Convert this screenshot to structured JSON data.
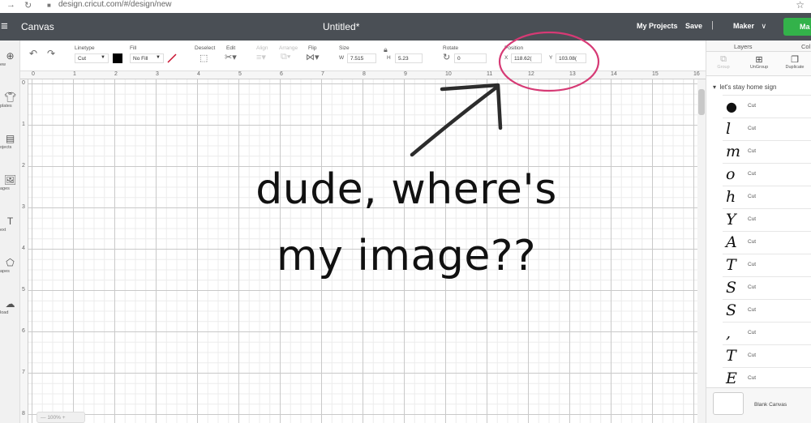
{
  "browser": {
    "nav_icons": [
      "arrow-right-icon",
      "refresh-icon",
      "lock-icon"
    ],
    "url": "design.cricut.com/#/design/new",
    "bookmark_icon": "star-icon"
  },
  "header": {
    "menu_icon": "hamburger-icon",
    "app_title": "Canvas",
    "doc_title": "Untitled*",
    "my_projects": "My Projects",
    "save": "Save",
    "separator": "|",
    "machine": "Maker",
    "machine_chevron": "∨",
    "make_label": "Ma",
    "accent_color": "#33b24a",
    "bg_color": "#4a4f55"
  },
  "toolbar": {
    "undo_icon": "undo-icon",
    "redo_icon": "redo-icon",
    "linetype_label": "Linetype",
    "linetype_value": "Cut",
    "fill_label": "Fill",
    "fill_value": "No Fill",
    "deselect_label": "Deselect",
    "edit_label": "Edit",
    "align_label": "Align",
    "arrange_label": "Arrange",
    "flip_label": "Flip",
    "size_label": "Size",
    "size_w_label": "W",
    "size_w": "7.515",
    "size_h_label": "H",
    "size_h": "5.23",
    "rotate_label": "Rotate",
    "rotate_value": "0",
    "position_label": "Position",
    "pos_x_label": "X",
    "pos_x": "118.62(",
    "pos_y_label": "Y",
    "pos_y": "103.08("
  },
  "left_nav": [
    {
      "icon": "plus-icon",
      "label": "ew"
    },
    {
      "icon": "shirt-icon",
      "label": "plates"
    },
    {
      "icon": "projects-icon",
      "label": "ojects"
    },
    {
      "icon": "images-icon",
      "label": "ages"
    },
    {
      "icon": "text-icon",
      "label": "ext"
    },
    {
      "icon": "shapes-icon",
      "label": "apes"
    },
    {
      "icon": "upload-icon",
      "label": "load"
    }
  ],
  "ruler": {
    "h": [
      "0",
      "1",
      "2",
      "3",
      "4",
      "5",
      "6",
      "7",
      "8",
      "9",
      "10",
      "11",
      "12",
      "13",
      "14",
      "15",
      "16"
    ],
    "v": [
      "0",
      "1",
      "2",
      "3",
      "4",
      "5",
      "6",
      "7",
      "8"
    ]
  },
  "zoom": "100%",
  "caption": {
    "line1": "dude, where's",
    "line2": "my image??"
  },
  "annotation_color": "#d63a75",
  "right_panel": {
    "tab_layers": "Layers",
    "tab_color": "Col",
    "tools": [
      {
        "icon": "group-icon",
        "label": "Group",
        "enabled": false
      },
      {
        "icon": "ungroup-icon",
        "label": "UnGroup",
        "enabled": true
      },
      {
        "icon": "duplicate-icon",
        "label": "Duplicate",
        "enabled": true
      }
    ],
    "group_name": "let's stay home sign",
    "layers": [
      {
        "glyph": "●",
        "label": "Cut"
      },
      {
        "glyph": "l",
        "label": "Cut"
      },
      {
        "glyph": "m",
        "label": "Cut"
      },
      {
        "glyph": "o",
        "label": "Cut"
      },
      {
        "glyph": "h",
        "label": "Cut"
      },
      {
        "glyph": "Y",
        "label": "Cut"
      },
      {
        "glyph": "A",
        "label": "Cut"
      },
      {
        "glyph": "T",
        "label": "Cut"
      },
      {
        "glyph": "S",
        "label": "Cut"
      },
      {
        "glyph": "S",
        "label": "Cut"
      },
      {
        "glyph": ",",
        "label": "Cut"
      },
      {
        "glyph": "T",
        "label": "Cut"
      },
      {
        "glyph": "E",
        "label": "Cut"
      }
    ],
    "blank_canvas": "Blank Canvas"
  }
}
